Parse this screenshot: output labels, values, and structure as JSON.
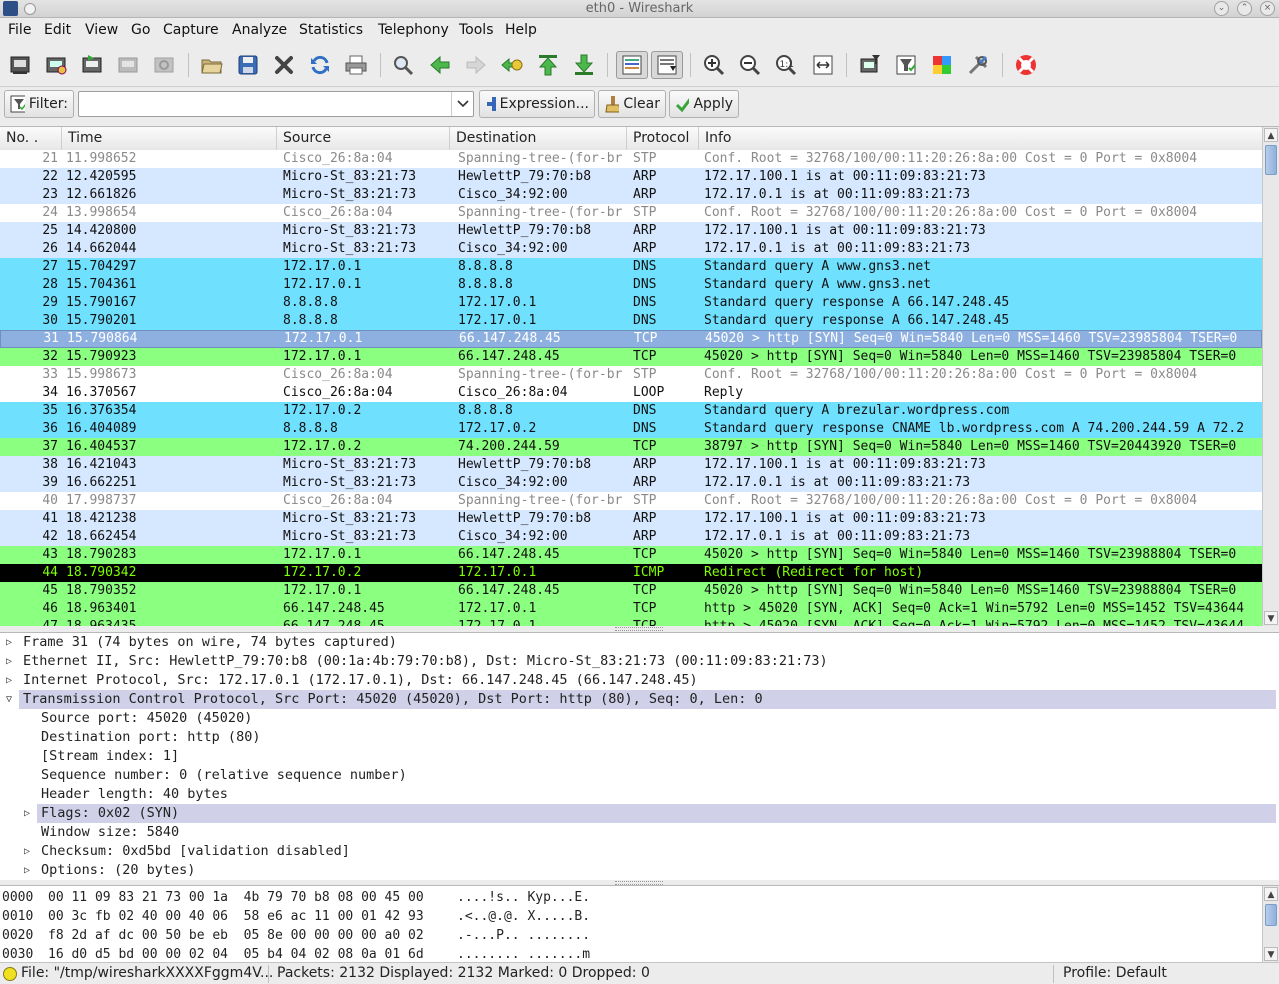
{
  "window": {
    "title": "eth0 - Wireshark"
  },
  "menu": [
    "File",
    "Edit",
    "View",
    "Go",
    "Capture",
    "Analyze",
    "Statistics",
    "Telephony",
    "Tools",
    "Help"
  ],
  "filter": {
    "label": "Filter:",
    "value": "",
    "expression_label": "Expression...",
    "clear_label": "Clear",
    "apply_label": "Apply"
  },
  "columns": [
    "No. .",
    "Time",
    "Source",
    "Destination",
    "Protocol",
    "Info"
  ],
  "colors": {
    "stp": "#ffffff",
    "arp": "#d6e8ff",
    "dns": "#70e0ff",
    "tcp": "#a0ffa0",
    "tcp_syn": "#8bff7f",
    "loop": "#ffffff",
    "icmp": "#000000",
    "selected": "#8eb0e0",
    "detail_hl": "#d0d0e8"
  },
  "packets": [
    {
      "no": "21",
      "time": "11.998652",
      "src": "Cisco_26:8a:04",
      "dst": "Spanning-tree-(for-br",
      "proto": "STP",
      "info": "Conf. Root = 32768/100/00:11:20:26:8a:00  Cost = 0  Port = 0x8004",
      "kind": "stp"
    },
    {
      "no": "22",
      "time": "12.420595",
      "src": "Micro-St_83:21:73",
      "dst": "HewlettP_79:70:b8",
      "proto": "ARP",
      "info": "172.17.100.1 is at 00:11:09:83:21:73",
      "kind": "arp"
    },
    {
      "no": "23",
      "time": "12.661826",
      "src": "Micro-St_83:21:73",
      "dst": "Cisco_34:92:00",
      "proto": "ARP",
      "info": "172.17.0.1 is at 00:11:09:83:21:73",
      "kind": "arp"
    },
    {
      "no": "24",
      "time": "13.998654",
      "src": "Cisco_26:8a:04",
      "dst": "Spanning-tree-(for-br",
      "proto": "STP",
      "info": "Conf. Root = 32768/100/00:11:20:26:8a:00  Cost = 0  Port = 0x8004",
      "kind": "stp"
    },
    {
      "no": "25",
      "time": "14.420800",
      "src": "Micro-St_83:21:73",
      "dst": "HewlettP_79:70:b8",
      "proto": "ARP",
      "info": "172.17.100.1 is at 00:11:09:83:21:73",
      "kind": "arp"
    },
    {
      "no": "26",
      "time": "14.662044",
      "src": "Micro-St_83:21:73",
      "dst": "Cisco_34:92:00",
      "proto": "ARP",
      "info": "172.17.0.1 is at 00:11:09:83:21:73",
      "kind": "arp"
    },
    {
      "no": "27",
      "time": "15.704297",
      "src": "172.17.0.1",
      "dst": "8.8.8.8",
      "proto": "DNS",
      "info": "Standard query A www.gns3.net",
      "kind": "dns"
    },
    {
      "no": "28",
      "time": "15.704361",
      "src": "172.17.0.1",
      "dst": "8.8.8.8",
      "proto": "DNS",
      "info": "Standard query A www.gns3.net",
      "kind": "dns"
    },
    {
      "no": "29",
      "time": "15.790167",
      "src": "8.8.8.8",
      "dst": "172.17.0.1",
      "proto": "DNS",
      "info": "Standard query response A 66.147.248.45",
      "kind": "dns"
    },
    {
      "no": "30",
      "time": "15.790201",
      "src": "8.8.8.8",
      "dst": "172.17.0.1",
      "proto": "DNS",
      "info": "Standard query response A 66.147.248.45",
      "kind": "dns"
    },
    {
      "no": "31",
      "time": "15.790864",
      "src": "172.17.0.1",
      "dst": "66.147.248.45",
      "proto": "TCP",
      "info": "45020 > http [SYN] Seq=0 Win=5840 Len=0 MSS=1460 TSV=23985804 TSER=0",
      "kind": "selected"
    },
    {
      "no": "32",
      "time": "15.790923",
      "src": "172.17.0.1",
      "dst": "66.147.248.45",
      "proto": "TCP",
      "info": "45020 > http [SYN] Seq=0 Win=5840 Len=0 MSS=1460 TSV=23985804 TSER=0",
      "kind": "tcp_syn"
    },
    {
      "no": "33",
      "time": "15.998673",
      "src": "Cisco_26:8a:04",
      "dst": "Spanning-tree-(for-br",
      "proto": "STP",
      "info": "Conf. Root = 32768/100/00:11:20:26:8a:00  Cost = 0  Port = 0x8004",
      "kind": "stp"
    },
    {
      "no": "34",
      "time": "16.370567",
      "src": "Cisco_26:8a:04",
      "dst": "Cisco_26:8a:04",
      "proto": "LOOP",
      "info": "Reply",
      "kind": "loop"
    },
    {
      "no": "35",
      "time": "16.376354",
      "src": "172.17.0.2",
      "dst": "8.8.8.8",
      "proto": "DNS",
      "info": "Standard query A brezular.wordpress.com",
      "kind": "dns"
    },
    {
      "no": "36",
      "time": "16.404089",
      "src": "8.8.8.8",
      "dst": "172.17.0.2",
      "proto": "DNS",
      "info": "Standard query response CNAME lb.wordpress.com A 74.200.244.59 A 72.2",
      "kind": "dns"
    },
    {
      "no": "37",
      "time": "16.404537",
      "src": "172.17.0.2",
      "dst": "74.200.244.59",
      "proto": "TCP",
      "info": "38797 > http [SYN] Seq=0 Win=5840 Len=0 MSS=1460 TSV=20443920 TSER=0",
      "kind": "tcp_syn"
    },
    {
      "no": "38",
      "time": "16.421043",
      "src": "Micro-St_83:21:73",
      "dst": "HewlettP_79:70:b8",
      "proto": "ARP",
      "info": "172.17.100.1 is at 00:11:09:83:21:73",
      "kind": "arp"
    },
    {
      "no": "39",
      "time": "16.662251",
      "src": "Micro-St_83:21:73",
      "dst": "Cisco_34:92:00",
      "proto": "ARP",
      "info": "172.17.0.1 is at 00:11:09:83:21:73",
      "kind": "arp"
    },
    {
      "no": "40",
      "time": "17.998737",
      "src": "Cisco_26:8a:04",
      "dst": "Spanning-tree-(for-br",
      "proto": "STP",
      "info": "Conf. Root = 32768/100/00:11:20:26:8a:00  Cost = 0  Port = 0x8004",
      "kind": "stp"
    },
    {
      "no": "41",
      "time": "18.421238",
      "src": "Micro-St_83:21:73",
      "dst": "HewlettP_79:70:b8",
      "proto": "ARP",
      "info": "172.17.100.1 is at 00:11:09:83:21:73",
      "kind": "arp"
    },
    {
      "no": "42",
      "time": "18.662454",
      "src": "Micro-St_83:21:73",
      "dst": "Cisco_34:92:00",
      "proto": "ARP",
      "info": "172.17.0.1 is at 00:11:09:83:21:73",
      "kind": "arp"
    },
    {
      "no": "43",
      "time": "18.790283",
      "src": "172.17.0.1",
      "dst": "66.147.248.45",
      "proto": "TCP",
      "info": "45020 > http [SYN] Seq=0 Win=5840 Len=0 MSS=1460 TSV=23988804 TSER=0",
      "kind": "tcp_syn"
    },
    {
      "no": "44",
      "time": "18.790342",
      "src": "172.17.0.2",
      "dst": "172.17.0.1",
      "proto": "ICMP",
      "info": "Redirect (Redirect for host)",
      "kind": "icmp"
    },
    {
      "no": "45",
      "time": "18.790352",
      "src": "172.17.0.1",
      "dst": "66.147.248.45",
      "proto": "TCP",
      "info": "45020 > http [SYN] Seq=0 Win=5840 Len=0 MSS=1460 TSV=23988804 TSER=0",
      "kind": "tcp_syn"
    },
    {
      "no": "46",
      "time": "18.963401",
      "src": "66.147.248.45",
      "dst": "172.17.0.1",
      "proto": "TCP",
      "info": "http > 45020 [SYN, ACK] Seq=0 Ack=1 Win=5792 Len=0 MSS=1452 TSV=43644",
      "kind": "tcp_syn"
    },
    {
      "no": "47",
      "time": "18.963435",
      "src": "66.147.248.45",
      "dst": "172.17.0.1",
      "proto": "TCP",
      "info": "http > 45020 [SYN, ACK] Seq=0 Ack=1 Win=5792 Len=0 MSS=1452 TSV=43644",
      "kind": "tcp_syn"
    }
  ],
  "details": [
    {
      "text": "Frame 31 (74 bytes on wire, 74 bytes captured)",
      "level": 0,
      "expander": "closed",
      "hl": false
    },
    {
      "text": "Ethernet II, Src: HewlettP_79:70:b8 (00:1a:4b:79:70:b8), Dst: Micro-St_83:21:73 (00:11:09:83:21:73)",
      "level": 0,
      "expander": "closed",
      "hl": false
    },
    {
      "text": "Internet Protocol, Src: 172.17.0.1 (172.17.0.1), Dst: 66.147.248.45 (66.147.248.45)",
      "level": 0,
      "expander": "closed",
      "hl": false
    },
    {
      "text": "Transmission Control Protocol, Src Port: 45020 (45020), Dst Port: http (80), Seq: 0, Len: 0",
      "level": 0,
      "expander": "open",
      "hl": true
    },
    {
      "text": "Source port: 45020 (45020)",
      "level": 1,
      "expander": "none",
      "hl": false
    },
    {
      "text": "Destination port: http (80)",
      "level": 1,
      "expander": "none",
      "hl": false
    },
    {
      "text": "[Stream index: 1]",
      "level": 1,
      "expander": "none",
      "hl": false
    },
    {
      "text": "Sequence number: 0    (relative sequence number)",
      "level": 1,
      "expander": "none",
      "hl": false
    },
    {
      "text": "Header length: 40 bytes",
      "level": 1,
      "expander": "none",
      "hl": false
    },
    {
      "text": "Flags: 0x02 (SYN)",
      "level": 1,
      "expander": "closed",
      "hl": true
    },
    {
      "text": "Window size: 5840",
      "level": 1,
      "expander": "none",
      "hl": false
    },
    {
      "text": "Checksum: 0xd5bd [validation disabled]",
      "level": 1,
      "expander": "closed",
      "hl": false
    },
    {
      "text": "Options: (20 bytes)",
      "level": 1,
      "expander": "closed",
      "hl": false
    }
  ],
  "bytes": [
    {
      "offset": "0000",
      "hex": "00 11 09 83 21 73 00 1a  4b 79 70 b8 08 00 45 00",
      "ascii": "....!s.. Kyp...E."
    },
    {
      "offset": "0010",
      "hex": "00 3c fb 02 40 00 40 06  58 e6 ac 11 00 01 42 93",
      "ascii": ".<..@.@. X.....B."
    },
    {
      "offset": "0020",
      "hex": "f8 2d af dc 00 50 be eb  05 8e 00 00 00 00 a0 02",
      "ascii": ".-...P.. ........"
    },
    {
      "offset": "0030",
      "hex": "16 d0 d5 bd 00 00 02 04  05 b4 04 02 08 0a 01 6d",
      "ascii": "........ .......m"
    }
  ],
  "status": {
    "file": "File: \"/tmp/wiresharkXXXXFggm4V...",
    "packets": "Packets: 2132 Displayed: 2132 Marked: 0 Dropped: 0",
    "profile": "Profile: Default"
  }
}
